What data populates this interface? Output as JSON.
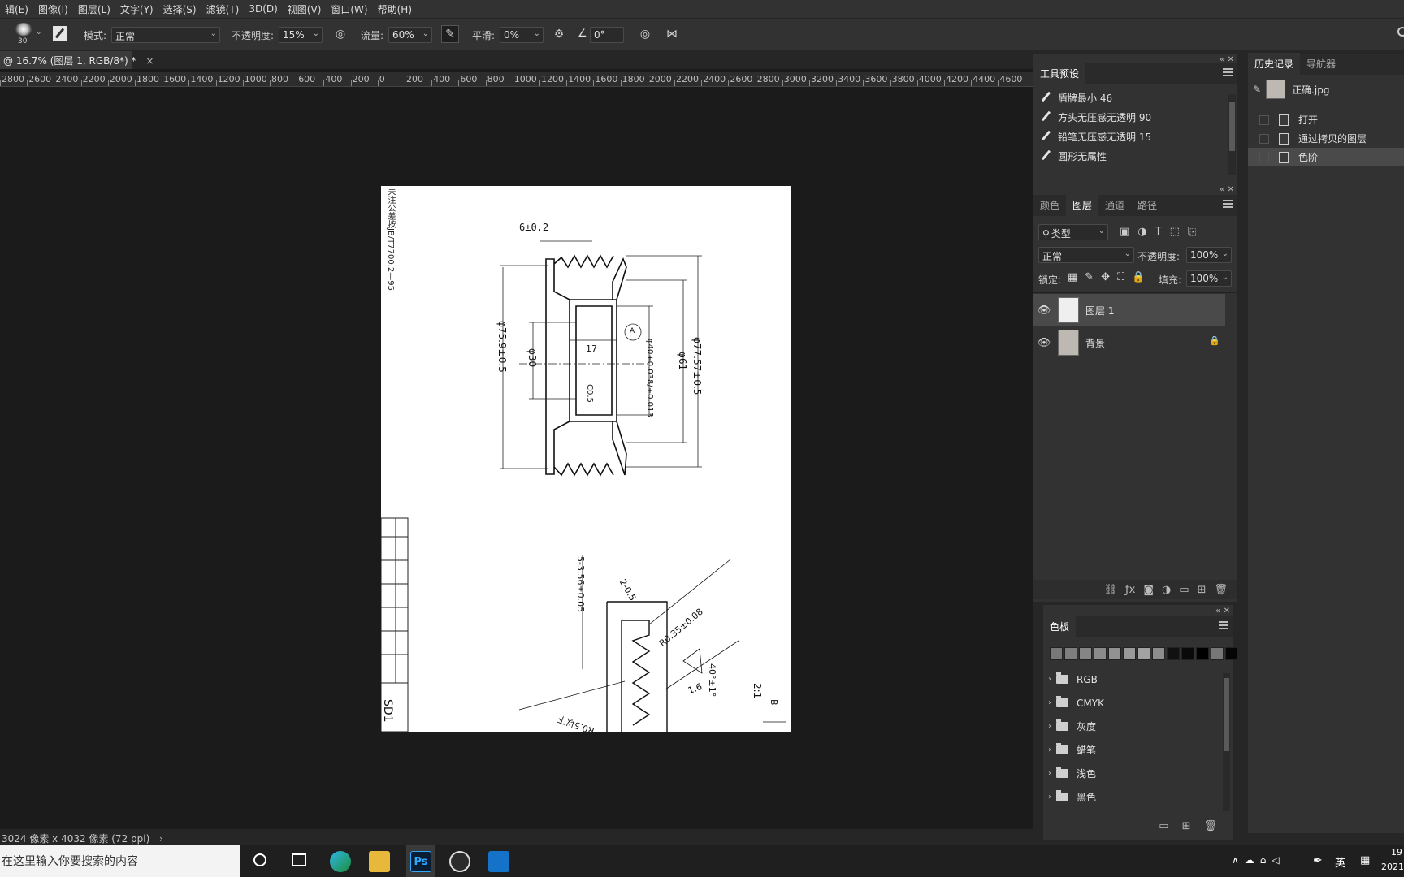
{
  "menu": [
    "辑(E)",
    "图像(I)",
    "图层(L)",
    "文字(Y)",
    "选择(S)",
    "滤镜(T)",
    "3D(D)",
    "视图(V)",
    "窗口(W)",
    "帮助(H)"
  ],
  "options": {
    "brush_size": "30",
    "mode_label": "模式:",
    "mode_value": "正常",
    "opacity_label": "不透明度:",
    "opacity_value": "15%",
    "flow_label": "流量:",
    "flow_value": "60%",
    "smoothing_label": "平滑:",
    "smoothing_value": "0%",
    "angle_value": "0°"
  },
  "document": {
    "tab_title": "@ 16.7% (图层 1, RGB/8*) *",
    "close_glyph": "×",
    "status": "3024 像素 x 4032 像素 (72 ppi)",
    "status_arrow": "›"
  },
  "ruler": [
    "2800",
    "2600",
    "2400",
    "2200",
    "2000",
    "1800",
    "1600",
    "1400",
    "1200",
    "1000",
    "800",
    "600",
    "400",
    "200",
    "0",
    "200",
    "400",
    "600",
    "800",
    "1000",
    "1200",
    "1400",
    "1600",
    "1800",
    "2000",
    "2200",
    "2400",
    "2600",
    "2800",
    "3000",
    "3200",
    "3400",
    "3600",
    "3800",
    "4000",
    "4200",
    "4400",
    "4600"
  ],
  "drawing_text": {
    "note": "未注公差按JB/T7700.2—95",
    "dim1": "6±0.2",
    "dim2": "φ75.9±0.5",
    "dim3": "φ30",
    "dim4": "17",
    "dim5": "φ40+0.038/+0.013",
    "dim6": "φ61",
    "dim7": "φ77.57±0.5",
    "dim8": "C0.5",
    "datum": "A",
    "dim9": "5-3.56±0.05",
    "dim10": "2-0.5",
    "dim11": "R0.35±0.08",
    "dim12": "40°±1°",
    "dim13": "1.6",
    "dim14": "R0.5以下",
    "scale": "2:1",
    "view": "B",
    "block": "SD1"
  },
  "presets_panel": {
    "tab": "工具预设",
    "items": [
      "盾牌最小 46",
      "方头无压感无透明 90",
      "铅笔无压感无透明 15",
      "圆形无属性"
    ]
  },
  "layers_panel": {
    "tabs": [
      "颜色",
      "图层",
      "通道",
      "路径"
    ],
    "filter_label": "类型",
    "blend": "正常",
    "opacity_label": "不透明度:",
    "opacity_value": "100%",
    "lock_label": "锁定:",
    "fill_label": "填充:",
    "fill_value": "100%",
    "layers": [
      {
        "name": "图层 1",
        "selected": true,
        "locked": false
      },
      {
        "name": "背景",
        "selected": false,
        "locked": true
      }
    ]
  },
  "history_panel": {
    "tabs": [
      "历史记录",
      "导航器"
    ],
    "snapshot": "正确.jpg",
    "items": [
      "打开",
      "通过拷贝的图层",
      "色阶"
    ]
  },
  "swatches_panel": {
    "tab": "色板",
    "colors": [
      "#787878",
      "#7e7e7e",
      "#858585",
      "#8b8b8b",
      "#929292",
      "#999999",
      "#a2a2a2",
      "#8d8d8d",
      "#111111",
      "#0a0a0a",
      "#000000",
      "#777777",
      "#050505"
    ],
    "groups": [
      "RGB",
      "CMYK",
      "灰度",
      "蜡笔",
      "浅色",
      "黑色"
    ]
  },
  "taskbar": {
    "search_placeholder": "在这里输入你要搜索的内容",
    "ps_label": "Ps",
    "ime": "英",
    "clock_time": "19",
    "clock_date": "2021"
  }
}
